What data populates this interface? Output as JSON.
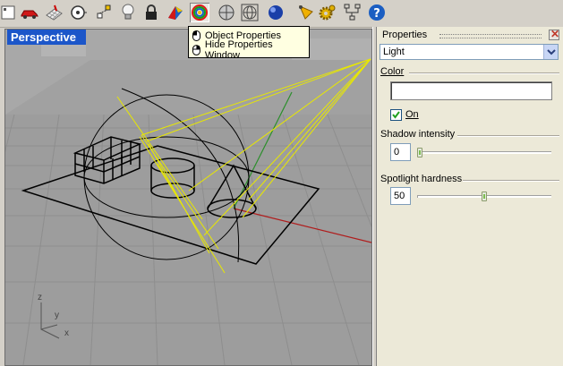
{
  "toolbar": {
    "buttons": [
      {
        "icon": "edit-layers-icon"
      },
      {
        "icon": "car-icon"
      },
      {
        "icon": "grid-icon"
      },
      {
        "icon": "osnap-icon"
      },
      {
        "icon": "points-icon"
      },
      {
        "icon": "lightbulb-icon"
      },
      {
        "icon": "lock-icon"
      },
      {
        "icon": "render-color-icon"
      },
      {
        "icon": "object-properties-icon",
        "pressed": true
      },
      {
        "icon": "shaded-sphere-icon"
      },
      {
        "icon": "wireframe-sphere-icon"
      },
      {
        "icon": "render-sphere-icon"
      },
      {
        "icon": "spotlight-cone-icon"
      },
      {
        "icon": "options-gear-icon"
      },
      {
        "icon": "hierarchy-icon"
      },
      {
        "icon": "help-icon"
      }
    ]
  },
  "tooltip": {
    "items": [
      "Object Properties",
      "Hide Properties Window"
    ]
  },
  "viewport": {
    "title": "Perspective",
    "axes": {
      "z": "z",
      "y": "y",
      "x": "x"
    }
  },
  "properties_panel": {
    "title": "Properties",
    "object_type": "Light",
    "color_label": "Color",
    "on_label": "On",
    "on_checked": true,
    "shadow_label": "Shadow intensity",
    "shadow_value": "0",
    "shadow_fraction": 0.0,
    "spotlight_label": "Spotlight hardness",
    "spotlight_value": "50",
    "spotlight_fraction": 0.5
  },
  "colors": {
    "viewport_title_bg": "#1c56c9",
    "light_lines": "#e8e800",
    "x_axis": "#b01c1c",
    "y_axis": "#2a8f2a",
    "tooltip_bg": "#ffffe1"
  }
}
